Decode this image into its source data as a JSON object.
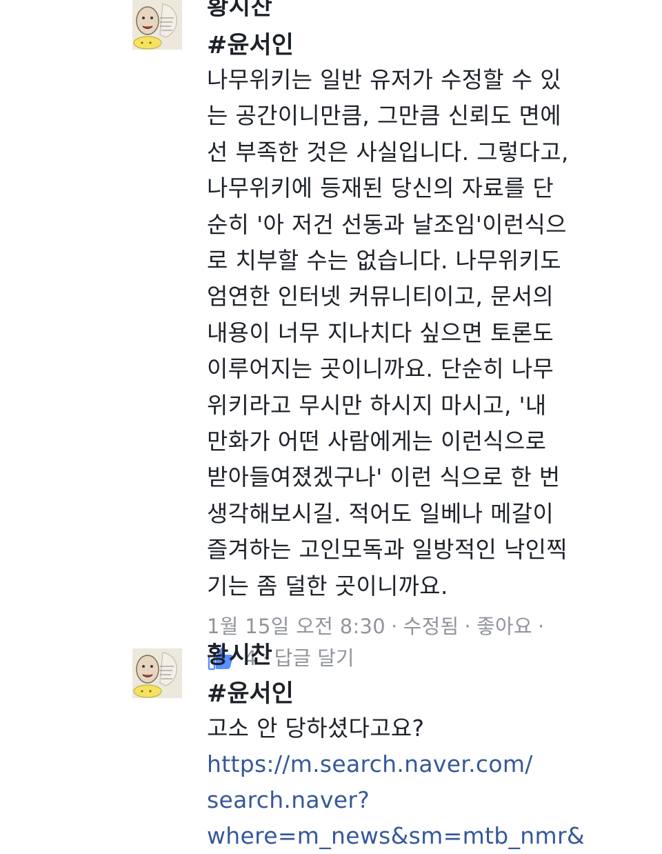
{
  "comments": [
    {
      "author": "황시찬",
      "hashtag": "#윤서인",
      "text": "나무위키는 일반 유저가 수정할 수 있\n는 공간이니만큼, 그만큼 신뢰도 면에\n선 부족한 것은 사실입니다. 그렇다고,\n나무위키에 등재된 당신의 자료를 단\n순히 '아 저건 선동과 날조임'이런식으\n로 치부할 수는 없습니다. 나무위키도\n엄연한 인터넷 커뮤니티이고, 문서의\n내용이 너무 지나치다 싶으면 토론도\n이루어지는 곳이니까요. 단순히 나무\n위키라고 무시만 하시지 마시고, '내\n만화가 어떤 사람에게는 이런식으로\n받아들여졌겠구나' 이런 식으로 한 번\n생각해보시길. 적어도 일베나 메갈이\n즐겨하는 고인모독과 일방적인 낙인찍\n기는 좀 덜한 곳이니까요.",
      "timestamp": "1월 15일 오전 8:30",
      "edited_label": "수정됨",
      "like_label": "좋아요",
      "like_count": "4",
      "reply_label": "답글 달기",
      "separator": "·"
    },
    {
      "author": "황시찬",
      "hashtag": "#윤서인",
      "text": "고소 안 당하셨다고요?",
      "link": "https://m.search.naver.com/\nsearch.naver?\nwhere=m_news&sm=mtb_nmr&"
    }
  ],
  "icons": {
    "avatar": "avatar-illustration",
    "like": "thumbs-up-icon"
  },
  "colors": {
    "text": "#1d2129",
    "meta": "#90949c",
    "link": "#365899",
    "like_blue": "#5890ff"
  }
}
